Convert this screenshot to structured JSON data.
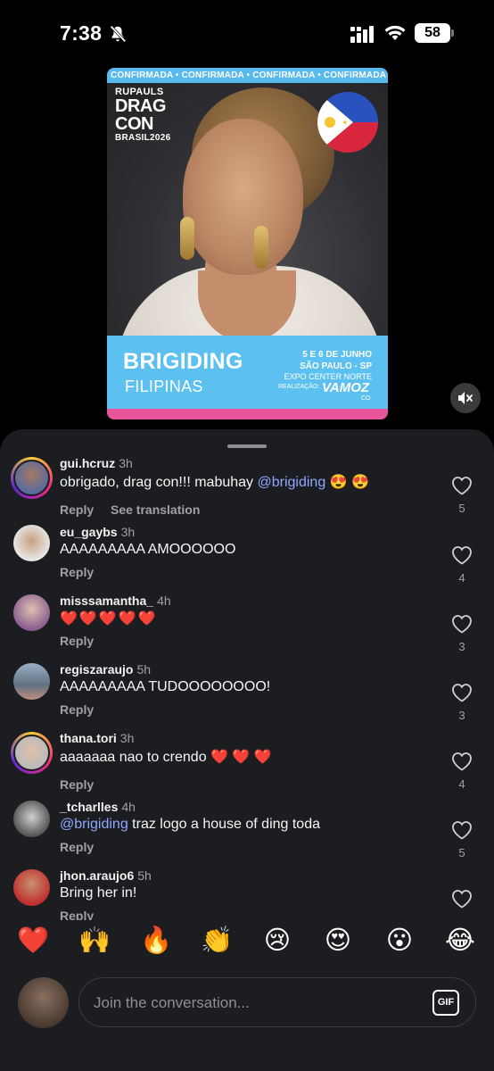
{
  "status_bar": {
    "time": "7:38",
    "battery": "58"
  },
  "poster": {
    "ticker": "CONFIRMADA • CONFIRMADA • CONFIRMADA • CONFIRMADA • CONFIRMADA",
    "brand_line1": "RUPAULS",
    "brand_line2": "DRAG",
    "brand_line3": "CON",
    "brand_line4": "BRASIL2026",
    "name": "BRIGIDING",
    "country": "FILIPINAS",
    "date": "5 E 6 DE JUNHO",
    "city": "SÃO PAULO - SP",
    "venue": "EXPO CENTER NORTE",
    "realizacao": "REALIZAÇÃO:",
    "organizer": "VAMOZ",
    "organizer_suffix": "CO"
  },
  "comments": [
    {
      "user": "gui.hcruz",
      "time": "3h",
      "text_pre": "obrigado, drag con!!! mabuhay ",
      "mention": "@brigiding",
      "text_post": " 😍 😍",
      "reply": "Reply",
      "translate": "See translation",
      "likes": "5"
    },
    {
      "user": "eu_gaybs",
      "time": "3h",
      "text": "AAAAAAAAA AMOOOOOO",
      "reply": "Reply",
      "likes": "4"
    },
    {
      "user": "misssamantha_",
      "time": "4h",
      "text": "❤️❤️❤️❤️❤️",
      "reply": "Reply",
      "likes": "3"
    },
    {
      "user": "regiszaraujo",
      "time": "5h",
      "text": "AAAAAAAAA TUDOOOOOOOO!",
      "reply": "Reply",
      "likes": "3"
    },
    {
      "user": "thana.tori",
      "time": "3h",
      "text": "aaaaaaa nao to crendo ❤️ ❤️ ❤️",
      "reply": "Reply",
      "likes": "4"
    },
    {
      "user": "_tcharlles",
      "time": "4h",
      "mention": "@brigiding",
      "text_post": " traz logo a house of ding toda",
      "reply": "Reply",
      "likes": "5"
    },
    {
      "user": "jhon.araujo6",
      "time": "5h",
      "text": "Bring her in!",
      "reply": "Reply",
      "likes": ""
    }
  ],
  "emoji_bar": [
    "❤️",
    "🙌",
    "🔥",
    "👏",
    "😢",
    "😍",
    "😮",
    "😂"
  ],
  "input": {
    "placeholder": "Join the conversation...",
    "gif_label": "GIF"
  },
  "colors": {
    "sheet_bg": "#1c1d21",
    "mention": "#8fa8ff",
    "poster_blue": "#5cc0f0",
    "poster_pink": "#e8559a"
  },
  "icons": [
    "bell-off-icon",
    "cellular-signal-icon",
    "wifi-icon",
    "battery-icon",
    "mute-icon",
    "heart-icon",
    "gif-icon"
  ]
}
